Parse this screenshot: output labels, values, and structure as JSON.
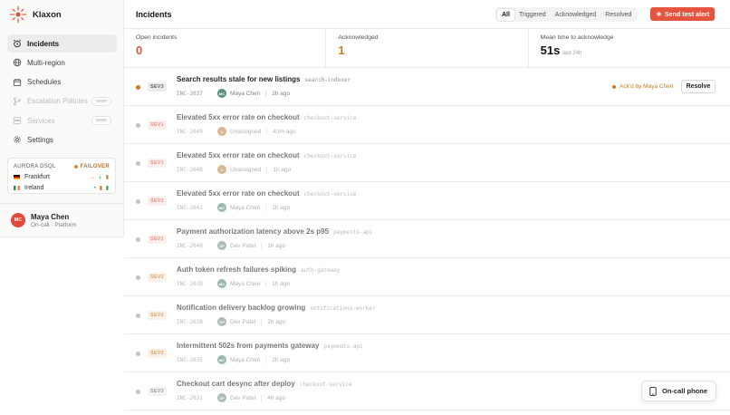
{
  "app": {
    "name": "Klaxon",
    "accent": "#e4543f"
  },
  "sidebar": {
    "items": [
      {
        "label": "Incidents",
        "icon": "alarm-icon",
        "active": true,
        "disabled": false
      },
      {
        "label": "Multi-region",
        "icon": "globe-icon",
        "active": false,
        "disabled": false
      },
      {
        "label": "Schedules",
        "icon": "calendar-icon",
        "active": false,
        "disabled": false
      },
      {
        "label": "Escalation Policies",
        "icon": "branch-icon",
        "active": false,
        "disabled": true,
        "badge": "soon"
      },
      {
        "label": "Services",
        "icon": "server-icon",
        "active": false,
        "disabled": true,
        "badge": "soon"
      },
      {
        "label": "Settings",
        "icon": "gear-icon",
        "active": false,
        "disabled": false
      }
    ],
    "database": {
      "title": "AURORA DSQL",
      "status": "FAILOVER",
      "regions": [
        {
          "name": "Frankfurt",
          "flag": "de"
        },
        {
          "name": "Ireland",
          "flag": "ie"
        }
      ]
    },
    "user": {
      "initials": "MC",
      "name": "Maya Chen",
      "role": "On-call · Platform"
    }
  },
  "header": {
    "title": "Incidents",
    "filters": [
      "All",
      "Triggered",
      "Acknowledged",
      "Resolved"
    ],
    "active_filter": "All",
    "send_label": "Send test alert"
  },
  "stats": {
    "open": {
      "label": "Open incidents",
      "value": "0"
    },
    "acknowledged": {
      "label": "Acknowledged",
      "value": "1"
    },
    "mtta": {
      "label": "Mean time to acknowledge",
      "value": "51s",
      "sub": "last 24h"
    }
  },
  "incidents": [
    {
      "sev": "SEV3",
      "title": "Search results stale for new listings",
      "service": "search-indexer",
      "id": "INC-2037",
      "assignee": "Maya Chen",
      "initials": "MC",
      "time": "2h ago",
      "ack_text": "Ack'd by Maya Chen",
      "action": "Resolve"
    },
    {
      "sev": "SEV1",
      "title": "Elevated 5xx error rate on checkout",
      "service": "checkout-service",
      "id": "INC-2049",
      "assignee": "Unassigned",
      "initials": "U",
      "time": "43m ago"
    },
    {
      "sev": "SEV1",
      "title": "Elevated 5xx error rate on checkout",
      "service": "checkout-service",
      "id": "INC-2048",
      "assignee": "Unassigned",
      "initials": "U",
      "time": "1h ago"
    },
    {
      "sev": "SEV1",
      "title": "Elevated 5xx error rate on checkout",
      "service": "checkout-service",
      "id": "INC-2041",
      "assignee": "Maya Chen",
      "initials": "MC",
      "time": "1h ago"
    },
    {
      "sev": "SEV1",
      "title": "Payment authorization latency above 2s p95",
      "service": "payments-api",
      "id": "INC-2040",
      "assignee": "Dev Patel",
      "initials": "DP",
      "time": "1h ago"
    },
    {
      "sev": "SEV2",
      "title": "Auth token refresh failures spiking",
      "service": "auth-gateway",
      "id": "INC-2039",
      "assignee": "Maya Chen",
      "initials": "MC",
      "time": "1h ago"
    },
    {
      "sev": "SEV2",
      "title": "Notification delivery backlog growing",
      "service": "notifications-worker",
      "id": "INC-2038",
      "assignee": "Dev Patel",
      "initials": "DP",
      "time": "2h ago"
    },
    {
      "sev": "SEV2",
      "title": "Intermittent 502s from payments gateway",
      "service": "payments-api",
      "id": "INC-2035",
      "assignee": "Maya Chen",
      "initials": "MC",
      "time": "2h ago"
    },
    {
      "sev": "SEV3",
      "title": "Checkout cart desync after deploy",
      "service": "checkout-service",
      "id": "INC-2031",
      "assignee": "Dev Patel",
      "initials": "DP",
      "time": "4h ago"
    }
  ],
  "oncall_button": "On-call phone"
}
